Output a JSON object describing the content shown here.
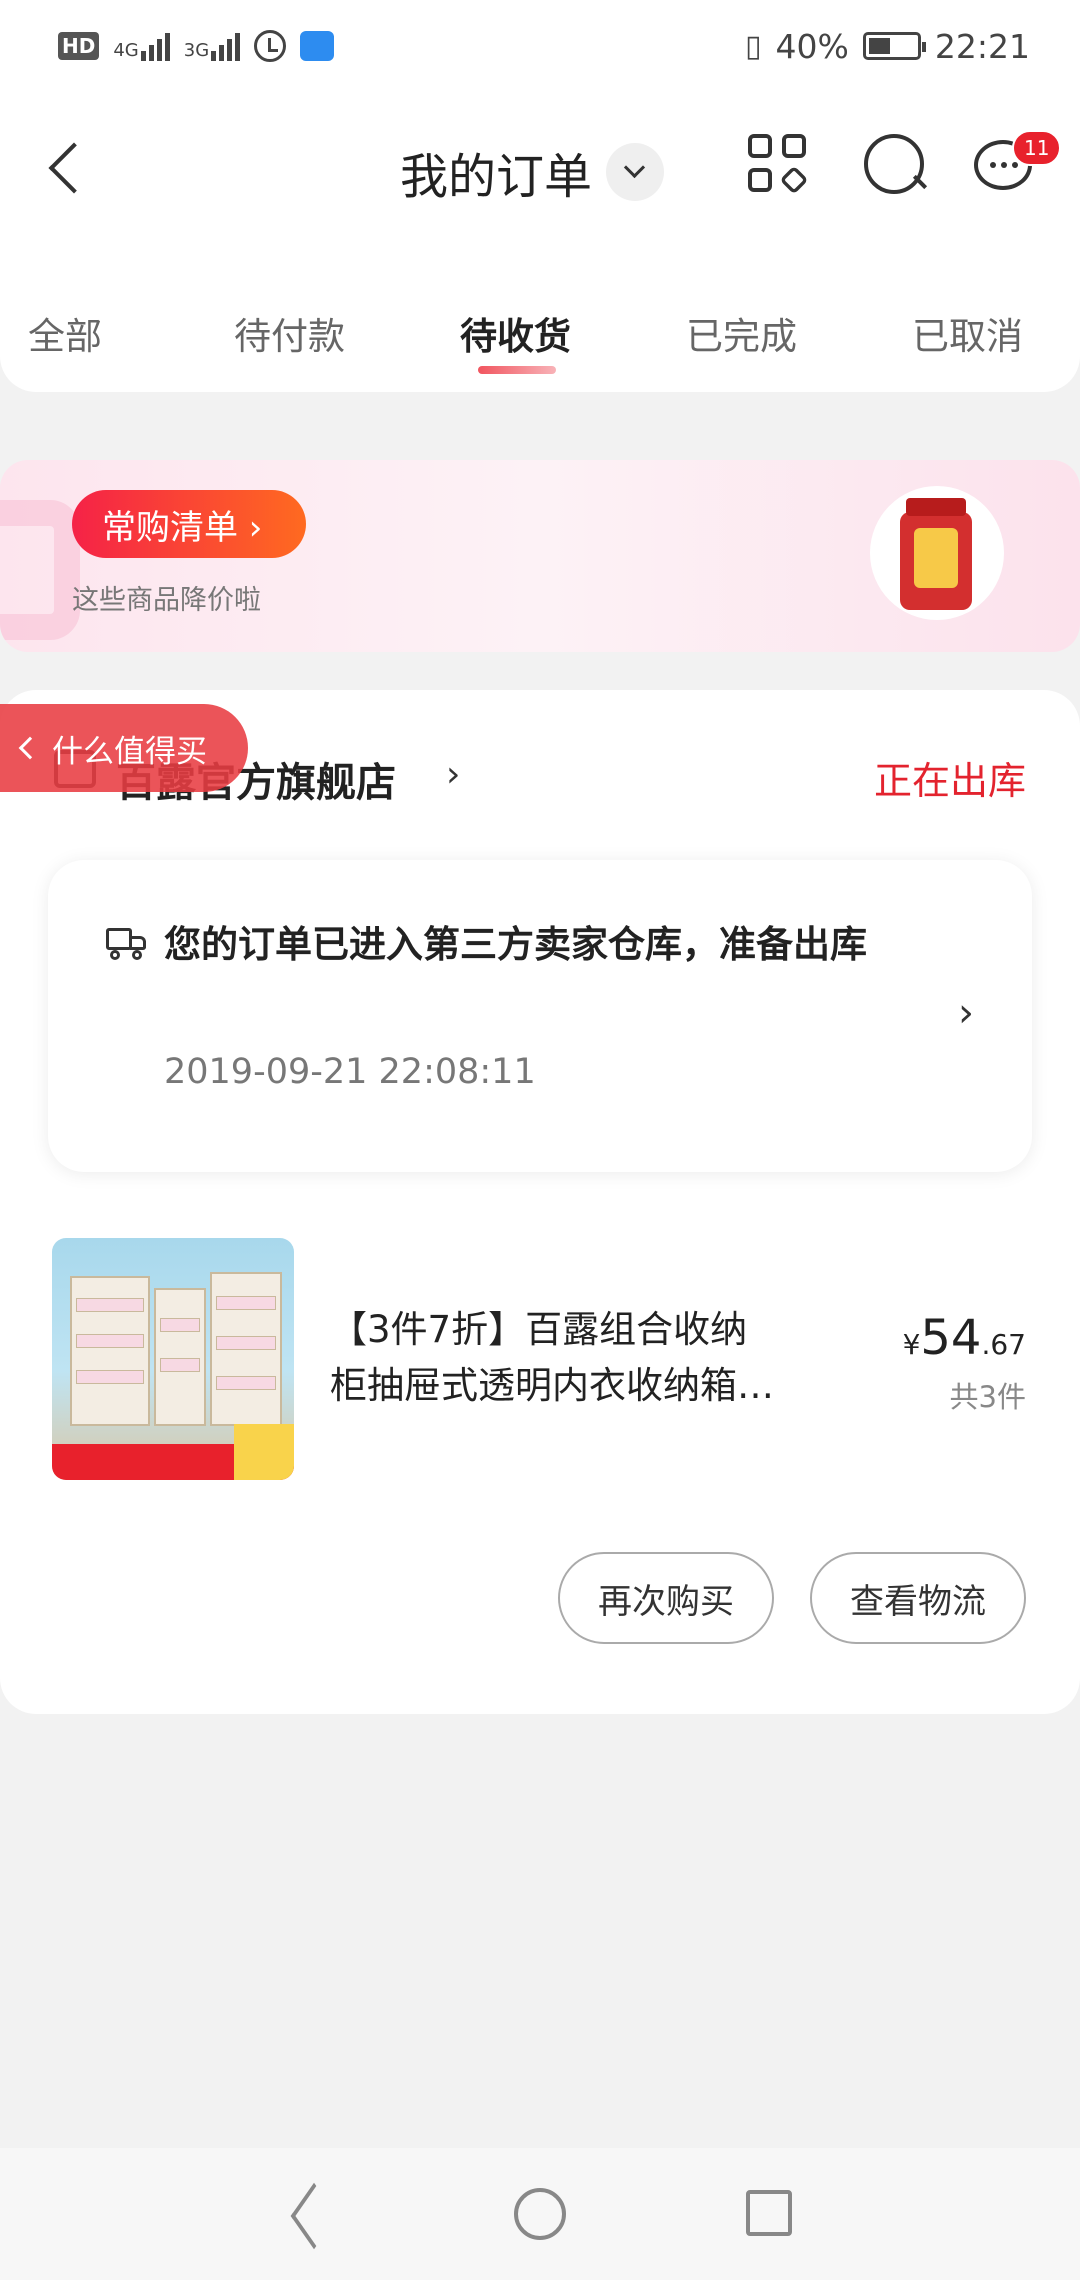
{
  "status_bar": {
    "network_1": "4G",
    "network_2": "3G",
    "battery": "40%",
    "time": "22:21"
  },
  "header": {
    "title": "我的订单",
    "message_badge": "11"
  },
  "tabs": [
    {
      "label": "全部",
      "active": false
    },
    {
      "label": "待付款",
      "active": false
    },
    {
      "label": "待收货",
      "active": true
    },
    {
      "label": "已完成",
      "active": false
    },
    {
      "label": "已取消",
      "active": false
    }
  ],
  "banner": {
    "button_label": "常购清单 ›",
    "subtitle": "这些商品降价啦"
  },
  "floating": {
    "label": "什么值得买"
  },
  "order": {
    "shop_name": "百露官方旗舰店",
    "status": "正在出库",
    "logistics": {
      "message": "您的订单已进入第三方卖家仓库，准备出库",
      "time": "2019-09-21 22:08:11"
    },
    "product": {
      "title_line1": "【3件7折】百露组合收纳",
      "title_line2": "柜抽屉式透明内衣收纳箱…",
      "price_symbol": "¥",
      "price_int": "54",
      "price_dec": ".67",
      "quantity": "共3件"
    },
    "buttons": {
      "rebuy": "再次购买",
      "logistics": "查看物流"
    }
  },
  "colors": {
    "accent_red": "#e3232e",
    "badge_red": "#e8212c"
  }
}
